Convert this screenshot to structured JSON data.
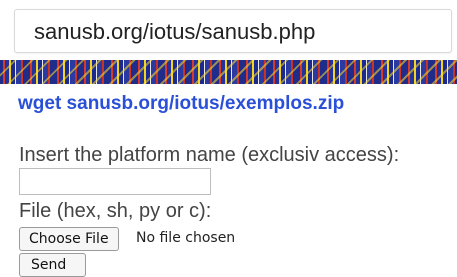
{
  "browser": {
    "url": "sanusb.org/iotus/sanusb.php"
  },
  "page": {
    "banner_icon": "decorative-banner",
    "download_link": "wget sanusb.org/iotus/exemplos.zip",
    "platform_label": "Insert the platform name (exclusiv access):",
    "platform_value": "",
    "file_label": "File (hex, sh, py or c):",
    "choose_file_label": "Choose File",
    "file_status": "No file chosen",
    "send_label": "Send"
  },
  "colors": {
    "link": "#2a4fd8",
    "text": "#444444"
  }
}
